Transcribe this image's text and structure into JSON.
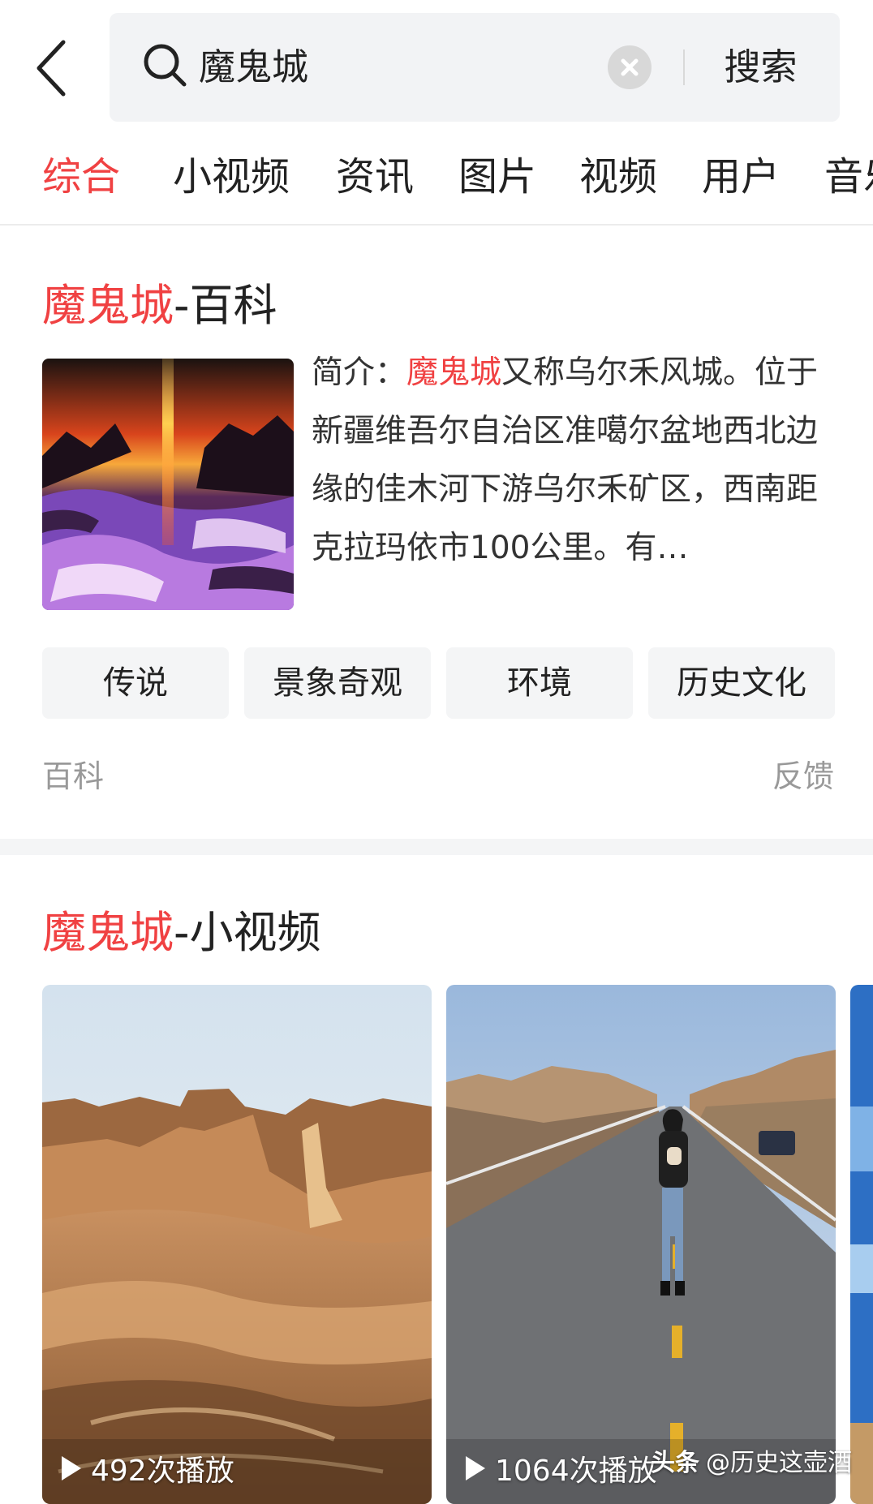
{
  "search": {
    "query": "魔鬼城",
    "button_label": "搜索"
  },
  "tabs": [
    {
      "label": "综合",
      "active": true
    },
    {
      "label": "小视频"
    },
    {
      "label": "资讯"
    },
    {
      "label": "图片"
    },
    {
      "label": "视频"
    },
    {
      "label": "用户"
    },
    {
      "label": "音乐"
    }
  ],
  "baike": {
    "title_highlight": "魔鬼城",
    "title_suffix": "-百科",
    "desc_prefix": "简介：",
    "desc_highlight": "魔鬼城",
    "desc_body": "又称乌尔禾风城。位于新疆维吾尔自治区准噶尔盆地西北边缘的佳木河下游乌尔禾矿区，西南距克拉玛依市100公里。有…",
    "chips": [
      "传说",
      "景象奇观",
      "环境",
      "历史文化"
    ],
    "source": "百科",
    "feedback": "反馈"
  },
  "videos": {
    "title_highlight": "魔鬼城",
    "title_suffix": "-小视频",
    "items": [
      {
        "plays": "492次播放"
      },
      {
        "plays": "1064次播放"
      }
    ]
  },
  "watermark": {
    "brand": "头条",
    "handle": "@历史这壶酒"
  },
  "colors": {
    "accent": "#f04142",
    "chip_bg": "#f4f5f6",
    "search_bg": "#f2f3f5"
  }
}
